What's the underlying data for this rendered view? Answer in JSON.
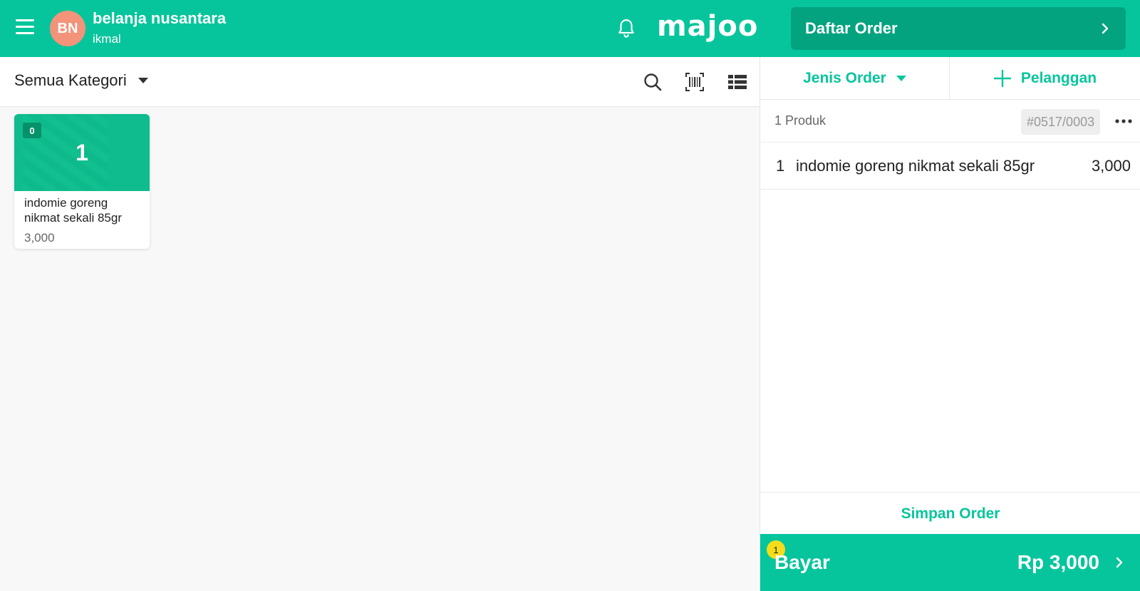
{
  "header": {
    "avatar_initials": "BN",
    "store_name": "belanja nusantara",
    "user_name": "ikmal",
    "logo_text": "majoo",
    "order_list_label": "Daftar Order"
  },
  "catalog": {
    "category_label": "Semua Kategori",
    "icons": [
      "search-icon",
      "barcode-icon",
      "list-view-icon"
    ]
  },
  "products": [
    {
      "name": "indomie goreng nikmat sekali 85gr",
      "price": "3,000",
      "stock": "0",
      "selected_qty": "1"
    }
  ],
  "order_panel": {
    "order_type_label": "Jenis Order",
    "customer_label": "Pelanggan",
    "product_count": "1 Produk",
    "order_number": "#0517/0003",
    "items": [
      {
        "qty": "1",
        "name": "indomie goreng nikmat sekali 85gr",
        "total": "3,000"
      }
    ],
    "save_label": "Simpan Order",
    "pay_label": "Bayar",
    "pay_badge": "1",
    "pay_total": "Rp 3,000"
  },
  "colors": {
    "brand": "#06c59c",
    "brand_dark": "#03a37f",
    "avatar": "#f3937a",
    "badge": "#f5dd1b"
  }
}
